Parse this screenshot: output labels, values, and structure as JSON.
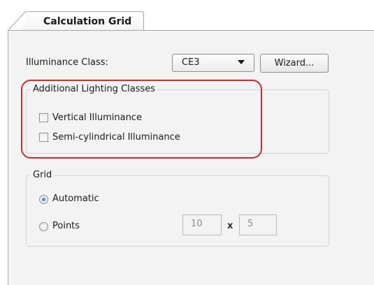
{
  "tab": {
    "label": "Calculation Grid"
  },
  "illuminance": {
    "label": "Illuminance Class:",
    "value": "CE3",
    "wizard_label": "Wizard..."
  },
  "additional": {
    "title": "Additional Lighting Classes",
    "items": [
      {
        "label": "Vertical Illuminance",
        "checked": false
      },
      {
        "label": "Semi-cylindrical Illuminance",
        "checked": false
      }
    ]
  },
  "grid": {
    "title": "Grid",
    "options": [
      {
        "label": "Automatic",
        "selected": true
      },
      {
        "label": "Points",
        "selected": false
      }
    ],
    "points_x": "10",
    "separator": "x",
    "points_y": "5"
  },
  "colors": {
    "highlight": "#d42a2a",
    "panel": "#f3f3f3"
  }
}
